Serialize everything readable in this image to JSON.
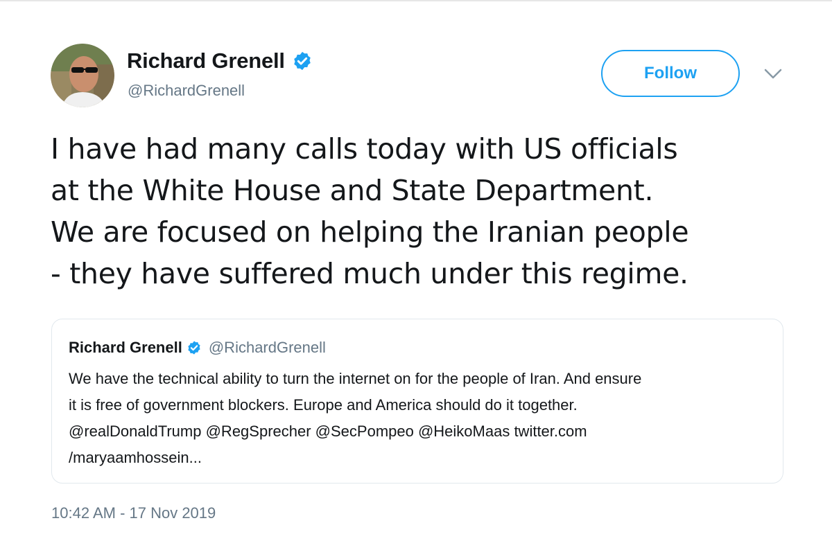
{
  "author": {
    "display_name": "Richard Grenell",
    "handle": "@RichardGrenell",
    "verified": true
  },
  "follow_button": {
    "label": "Follow"
  },
  "menu": {
    "icon": "chevron-down-icon"
  },
  "tweet": {
    "lines": [
      "I have had many calls today with US officials",
      "at the White House and State Department.",
      "We are focused on helping the Iranian people",
      "- they have suffered much under this regime."
    ]
  },
  "quoted_tweet": {
    "display_name": "Richard Grenell",
    "handle": "@RichardGrenell",
    "verified": true,
    "lines": [
      "We have the technical ability to turn the internet on for the people of Iran. And ensure",
      "it is free of government blockers. Europe and America should do it together.",
      "@realDonaldTrump @RegSprecher @SecPompeo @HeikoMaas twitter.com",
      "/maryaamhossein..."
    ]
  },
  "timestamp": "10:42 AM - 17 Nov 2019",
  "colors": {
    "accent": "#1da1f2",
    "text_primary": "#14171a",
    "text_secondary": "#657786",
    "border": "#e1e8ed"
  }
}
